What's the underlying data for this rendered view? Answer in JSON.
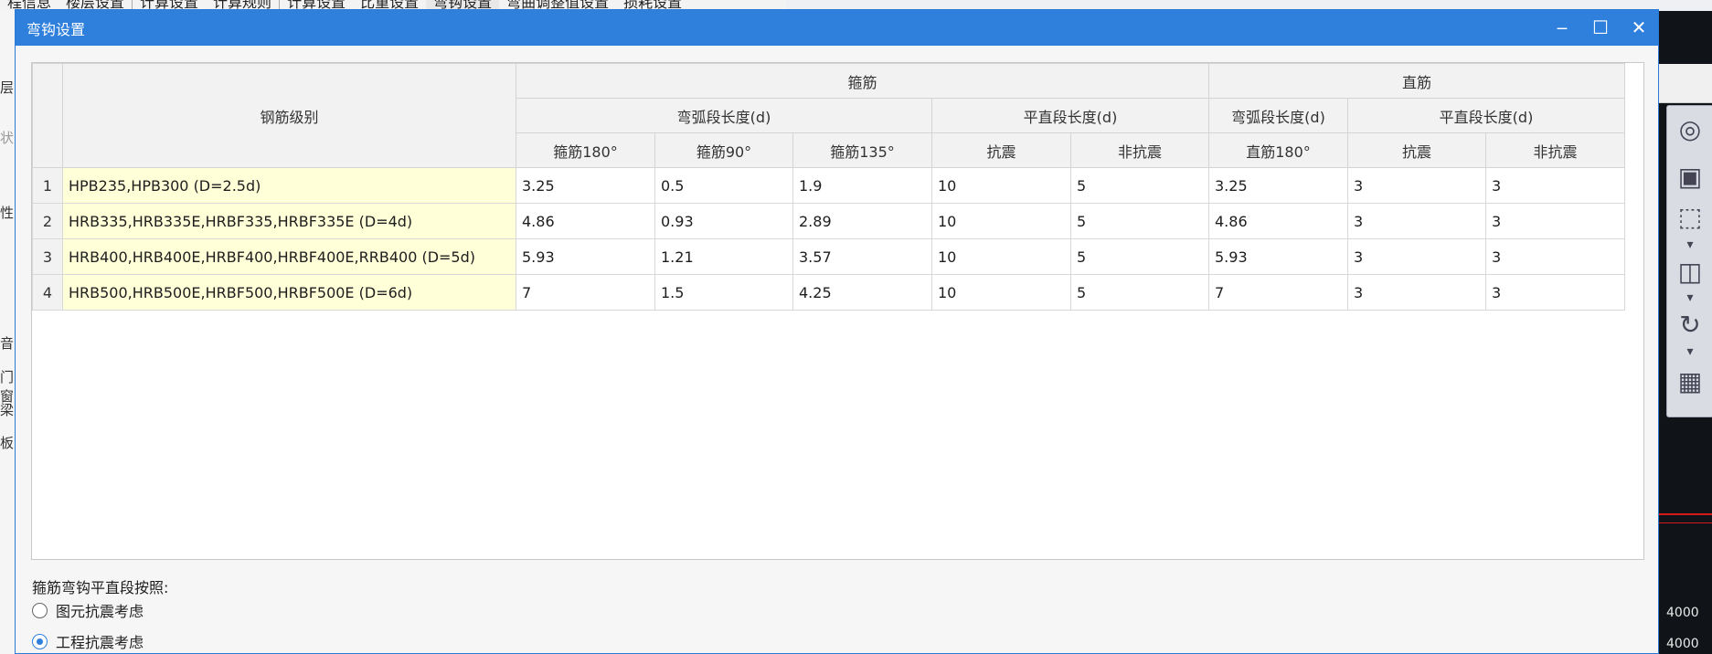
{
  "background": {
    "tabs": [
      "程信息",
      "楼层设置",
      "计算设置",
      "计算规则",
      "计算设置",
      "比重设置",
      "弯钩设置",
      "弯曲调整值设置",
      "损耗设置"
    ],
    "active_tab": "弯钩设置",
    "left_chars": [
      "层",
      "状",
      "性",
      "音",
      "门窗",
      "梁",
      "板"
    ],
    "readouts": [
      "4000",
      "4000"
    ]
  },
  "dialog": {
    "title": "弯钩设置",
    "controls": {
      "minimize": "‒",
      "maximize": "☐",
      "close": "✕"
    }
  },
  "table": {
    "header": {
      "grade": "钢筋级别",
      "stirrup": "箍筋",
      "straight": "直筋",
      "arc_length": "弯弧段长度(d)",
      "flat_length": "平直段长度(d)",
      "arc_length_straight": "弯弧段长度(d)",
      "flat_length_straight": "平直段长度(d)",
      "cols": [
        "箍筋180°",
        "箍筋90°",
        "箍筋135°",
        "抗震",
        "非抗震",
        "直筋180°",
        "抗震",
        "非抗震"
      ]
    },
    "rows": [
      {
        "no": "1",
        "grade": "HPB235,HPB300 (D=2.5d)",
        "values": [
          "3.25",
          "0.5",
          "1.9",
          "10",
          "5",
          "3.25",
          "3",
          "3"
        ]
      },
      {
        "no": "2",
        "grade": "HRB335,HRB335E,HRBF335,HRBF335E (D=4d)",
        "values": [
          "4.86",
          "0.93",
          "2.89",
          "10",
          "5",
          "4.86",
          "3",
          "3"
        ]
      },
      {
        "no": "3",
        "grade": "HRB400,HRB400E,HRBF400,HRBF400E,RRB400 (D=5d)",
        "values": [
          "5.93",
          "1.21",
          "3.57",
          "10",
          "5",
          "5.93",
          "3",
          "3"
        ]
      },
      {
        "no": "4",
        "grade": "HRB500,HRB500E,HRBF500,HRBF500E (D=6d)",
        "values": [
          "7",
          "1.5",
          "4.25",
          "10",
          "5",
          "7",
          "3",
          "3"
        ]
      }
    ]
  },
  "footer": {
    "label": "箍筋弯钩平直段按照:",
    "options": [
      {
        "label": "图元抗震考虑",
        "selected": false
      },
      {
        "label": "工程抗震考虑",
        "selected": true
      }
    ]
  }
}
